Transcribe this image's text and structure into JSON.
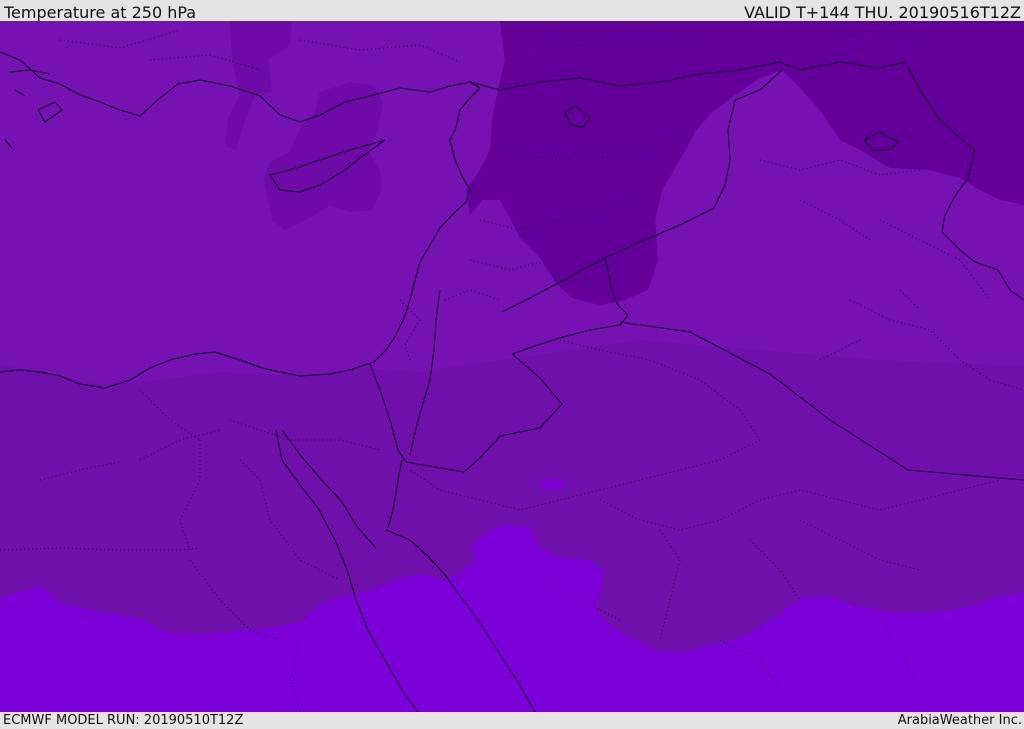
{
  "header": {
    "title": "Temperature at 250 hPa",
    "valid": "VALID T+144 THU. 20190516T12Z"
  },
  "footer": {
    "model_run": "ECMWF MODEL RUN: 20190510T12Z",
    "credit": "ArabiaWeather Inc."
  },
  "map": {
    "field": "temperature_250hPa",
    "colors": {
      "coldest": "#63009a",
      "cold": "#6d0aa8",
      "mid": "#7612b2",
      "mid2": "#7010aa",
      "warm": "#7c00d8",
      "warm_spot": "#7a00d4",
      "coastline": "#0a0320",
      "border": "#120428"
    }
  }
}
